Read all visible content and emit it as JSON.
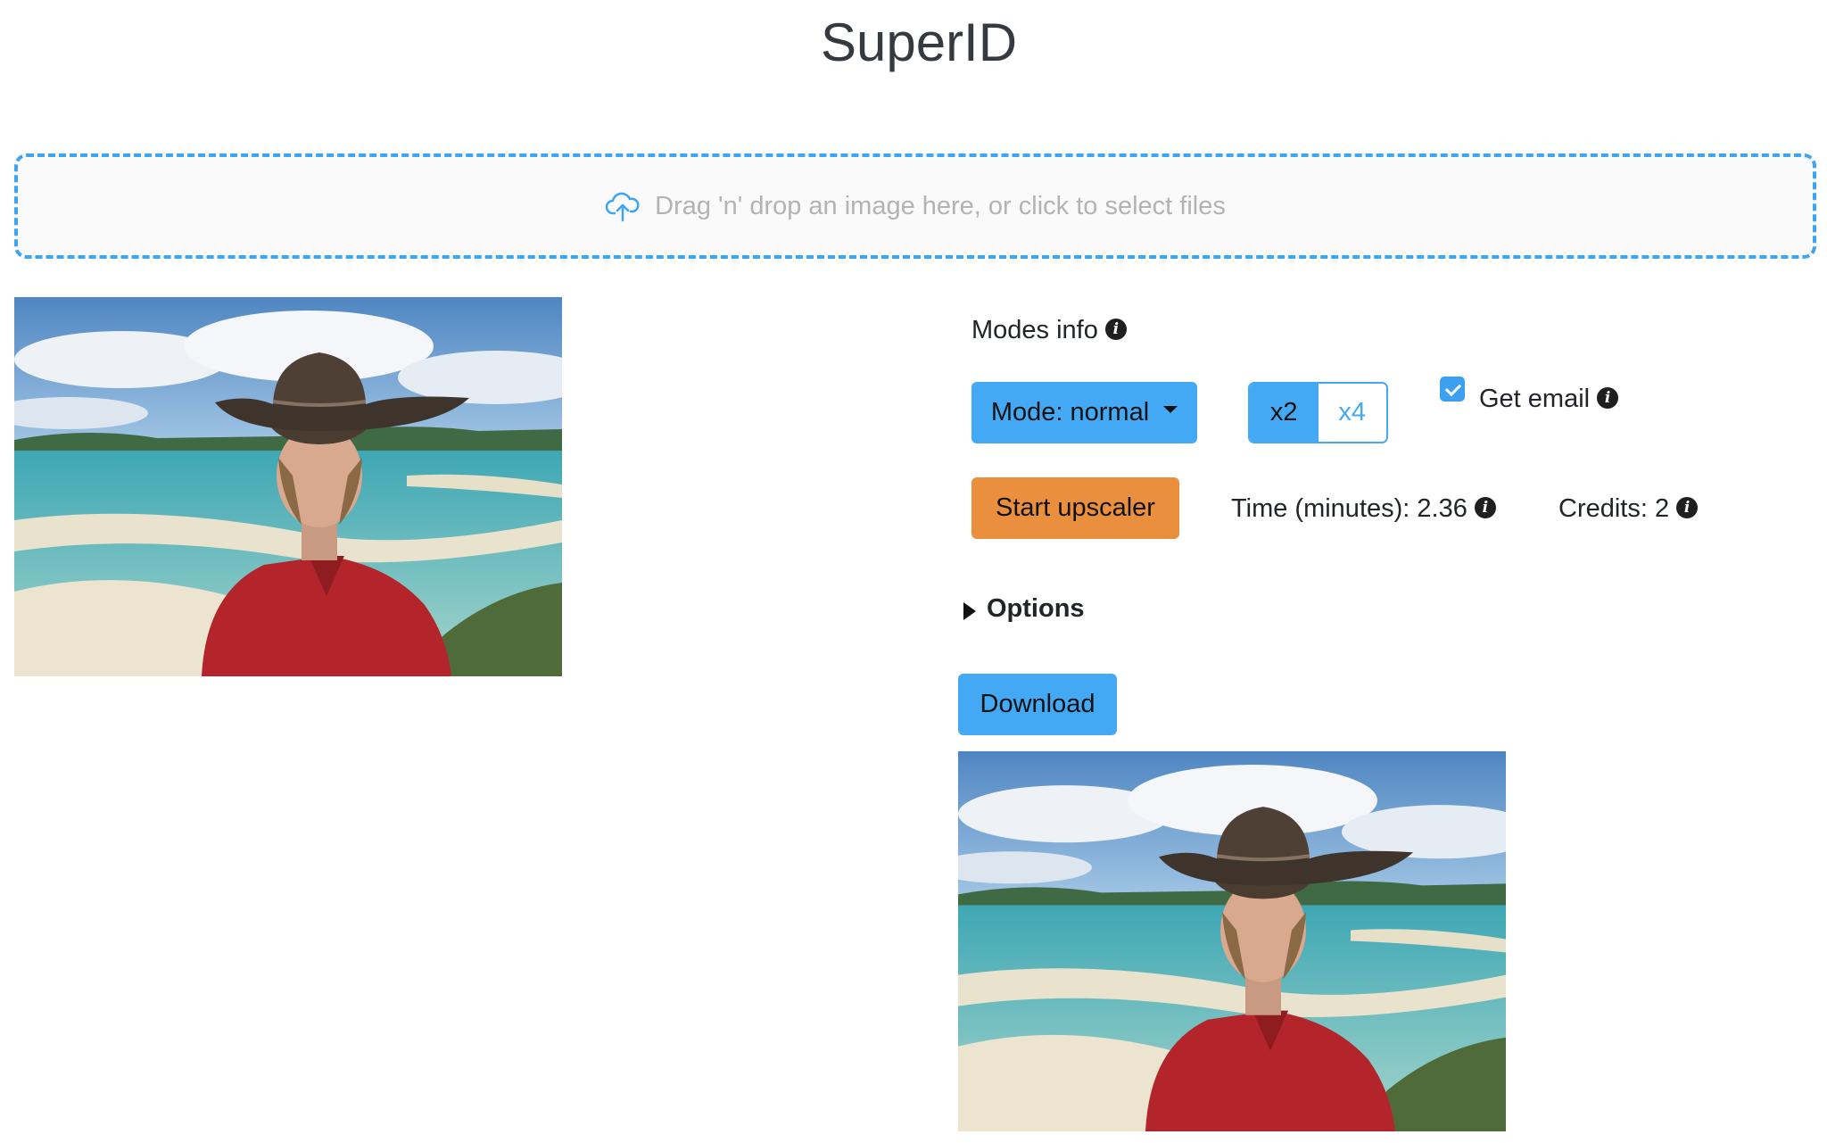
{
  "header": {
    "title": "SuperID"
  },
  "dropzone": {
    "text": "Drag 'n' drop an image here, or click to select files",
    "icon": "cloud-upload-icon",
    "border_color": "#3da5f4"
  },
  "images": {
    "original_alt": "Uploaded photo",
    "result_alt": "Upscaled photo"
  },
  "controls": {
    "modes_info_label": "Modes info",
    "mode_button_label": "Mode: normal",
    "scale_options": [
      {
        "label": "x2",
        "selected": true
      },
      {
        "label": "x4",
        "selected": false
      }
    ],
    "get_email": {
      "label": "Get email",
      "checked": true
    },
    "start_button_label": "Start upscaler",
    "time_label": "Time (minutes): 2.36",
    "credits_label": "Credits: 2",
    "options_label": "Options",
    "download_button_label": "Download"
  },
  "colors": {
    "primary": "#43a9f5",
    "start": "#ea8f3e",
    "muted_text": "#b3b3b3"
  },
  "icons": {
    "info": "info-icon",
    "caret": "caret-down-icon",
    "expand": "triangle-right-icon",
    "check": "check-icon"
  }
}
